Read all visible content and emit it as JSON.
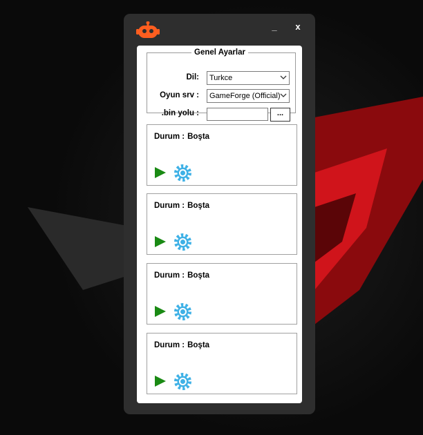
{
  "window": {
    "minimize_label": "_",
    "close_label": "x",
    "logo_icon": "robot-icon"
  },
  "settings": {
    "legend": "Genel Ayarlar",
    "language_label": "Dil:",
    "language_value": "Turkce",
    "server_label": "Oyun srv :",
    "server_value": "GameForge (Official)",
    "bin_label": ".bin yolu :",
    "bin_value": "",
    "browse_label": "..."
  },
  "slots": [
    {
      "status_label": "Durum :",
      "status_value": "Boşta"
    },
    {
      "status_label": "Durum :",
      "status_value": "Boşta"
    },
    {
      "status_label": "Durum :",
      "status_value": "Boşta"
    },
    {
      "status_label": "Durum :",
      "status_value": "Boşta"
    }
  ],
  "colors": {
    "logo": "#ff5e1f",
    "play": "#1a8a14",
    "gear": "#3fb1e6",
    "accent_bg": "#c0141b"
  }
}
